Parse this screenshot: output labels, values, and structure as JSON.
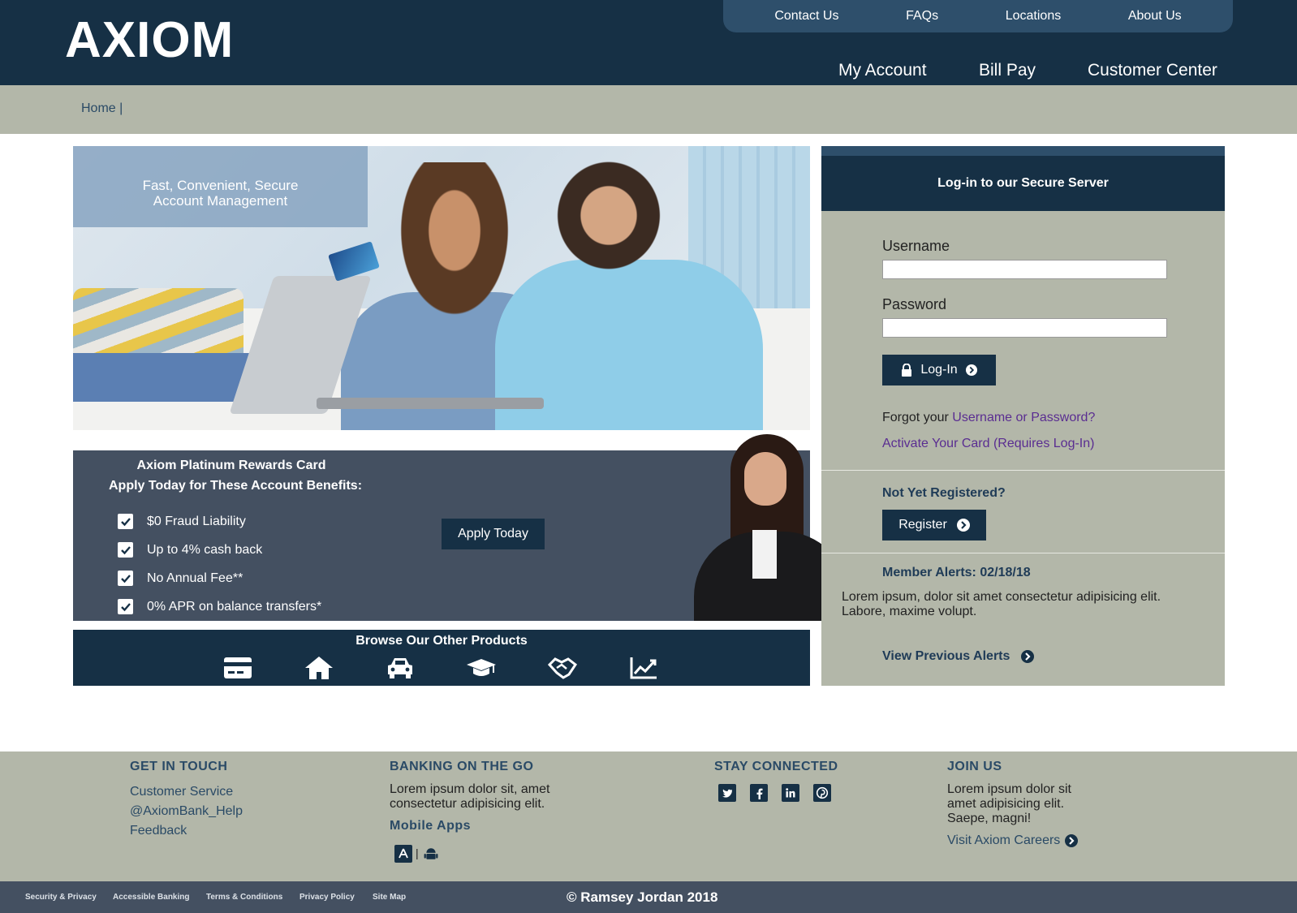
{
  "header": {
    "logo": "AXIOM",
    "top_nav": [
      "Contact Us",
      "FAQs",
      "Locations",
      "About Us"
    ],
    "main_nav": [
      "My Account",
      "Bill Pay",
      "Customer Center"
    ],
    "brand_color": "#163045"
  },
  "breadcrumb": {
    "home": "Home |"
  },
  "hero": {
    "caption_line1": "Fast, Convenient, Secure",
    "caption_line2": "Account Management"
  },
  "promo": {
    "title": "Axiom Platinum Rewards Card",
    "subtitle": "Apply Today for These Account Benefits:",
    "benefits": [
      "$0 Fraud Liability",
      "Up to 4% cash back",
      "No Annual Fee**",
      "0% APR on balance transfers*"
    ],
    "apply_label": "Apply Today"
  },
  "products": {
    "title": "Browse Our Other Products",
    "icons": [
      "credit-card-icon",
      "home-icon",
      "car-icon",
      "graduation-cap-icon",
      "handshake-icon",
      "line-chart-icon"
    ]
  },
  "login": {
    "header": "Log-in to our Secure Server",
    "username_label": "Username",
    "password_label": "Password",
    "username_value": "",
    "password_value": "",
    "login_label": "Log-In",
    "forgot_prefix": "Forgot your",
    "forgot_link": "Username or Password?",
    "activate_link": "Activate Your Card (Requires Log-In)",
    "not_registered": "Not Yet Registered?",
    "register_label": "Register",
    "alerts_title": "Member Alerts: 02/18/18",
    "alerts_text": "Lorem ipsum, dolor sit amet consectetur adipisicing elit. Labore, maxime volupt.",
    "view_previous": "View Previous Alerts"
  },
  "footer": {
    "get_in_touch": {
      "heading": "GET IN TOUCH",
      "links": [
        "Customer Service",
        "@AxiomBank_Help",
        "Feedback"
      ]
    },
    "banking_on_the_go": {
      "heading": "BANKING ON THE GO",
      "text": "Lorem ipsum dolor sit, amet consectetur adipisicing elit.",
      "mobile_apps": "Mobile Apps",
      "separator": "|"
    },
    "stay_connected": {
      "heading": "STAY CONNECTED",
      "icons": [
        "twitter-icon",
        "facebook-icon",
        "linkedin-icon",
        "pinterest-icon"
      ]
    },
    "join_us": {
      "heading": "JOIN US",
      "text": "Lorem ipsum dolor sit amet adipisicing elit. Saepe, magni!",
      "careers": "Visit Axiom Careers"
    },
    "bottom_links": [
      "Security & Privacy",
      "Accessible Banking",
      "Terms & Conditions",
      "Privacy Policy",
      "Site Map"
    ],
    "copyright": "© Ramsey Jordan 2018"
  }
}
